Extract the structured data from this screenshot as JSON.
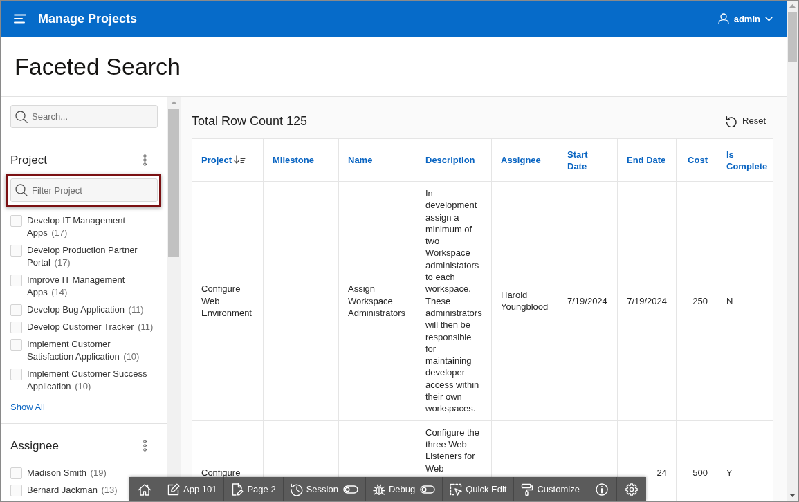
{
  "header": {
    "title": "Manage Projects",
    "user": "admin"
  },
  "page_title": "Faceted Search",
  "sidebar": {
    "search": {
      "placeholder": "Search..."
    },
    "facets": [
      {
        "title": "Project",
        "filter": {
          "placeholder": "Filter Project",
          "highlighted": true
        },
        "options": [
          {
            "label": "Develop IT Management Apps",
            "count": "(17)",
            "checked": false
          },
          {
            "label": "Develop Production Partner Portal",
            "count": "(17)",
            "checked": false
          },
          {
            "label": "Improve IT Management Apps",
            "count": "(14)",
            "checked": false
          },
          {
            "label": "Develop Bug Application",
            "count": "(11)",
            "checked": false
          },
          {
            "label": "Develop Customer Tracker",
            "count": "(11)",
            "checked": false
          },
          {
            "label": "Implement Customer Satisfaction Application",
            "count": "(10)",
            "checked": false
          },
          {
            "label": "Implement Customer Success Application",
            "count": "(10)",
            "checked": false
          }
        ],
        "show_all": "Show All"
      },
      {
        "title": "Assignee",
        "options": [
          {
            "label": "Madison Smith",
            "count": "(19)",
            "checked": false
          },
          {
            "label": "Bernard Jackman",
            "count": "(13)",
            "checked": false
          }
        ]
      }
    ]
  },
  "report": {
    "title": "Total Row Count 125",
    "reset": "Reset",
    "table": {
      "columns": [
        {
          "label": "Project",
          "sorted": true
        },
        {
          "label": "Milestone",
          "sorted": false
        },
        {
          "label": "Name",
          "sorted": false
        },
        {
          "label": "Description",
          "sorted": false
        },
        {
          "label": "Assignee",
          "sorted": false
        },
        {
          "label": "Start Date",
          "sorted": false
        },
        {
          "label": "End Date",
          "sorted": false
        },
        {
          "label": "Cost",
          "sorted": false
        },
        {
          "label": "Is Complete",
          "sorted": false
        }
      ],
      "rows": [
        {
          "project": "Configure Web Environment",
          "name": "Assign Workspace Administrators",
          "description": "In development assign a minimum of two Workspace administators to each workspace. These administrators will then be responsible for maintaining developer access within their own workspaces.",
          "assignee": "Harold Youngblood",
          "start_date": "7/19/2024",
          "end_date": "7/19/2024",
          "cost": "250",
          "is_complete": "N"
        },
        {
          "project": "Configure",
          "description": "Configure the three Web Listeners for Web",
          "end_date": "24",
          "cost": "500",
          "is_complete": "Y"
        }
      ]
    }
  },
  "developer_toolbar": [
    {
      "kind": "home"
    },
    {
      "kind": "app",
      "label": "App 101"
    },
    {
      "kind": "page",
      "label": "Page 2"
    },
    {
      "kind": "session",
      "label": "Session",
      "on": false
    },
    {
      "kind": "debug",
      "label": "Debug",
      "on": false
    },
    {
      "kind": "quick_edit",
      "label": "Quick Edit"
    },
    {
      "kind": "customize",
      "label": "Customize"
    },
    {
      "kind": "info"
    },
    {
      "kind": "settings"
    }
  ]
}
